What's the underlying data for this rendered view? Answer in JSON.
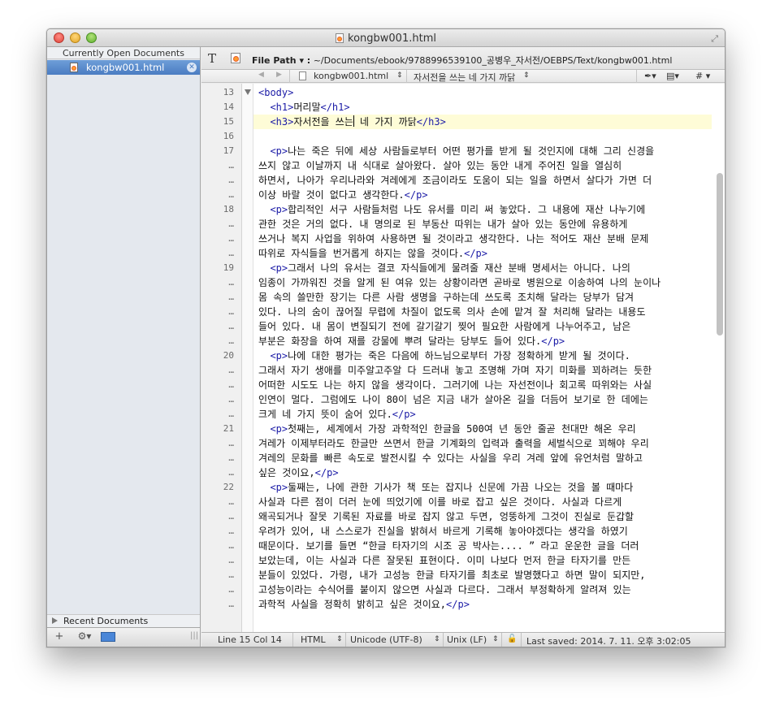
{
  "window": {
    "title": "kongbw001.html"
  },
  "sidebar": {
    "header": "Currently Open Documents",
    "open_docs": [
      {
        "name": "kongbw001.html"
      }
    ],
    "recent_label": "Recent Documents",
    "footer": {
      "add": "+",
      "gear": "⚙▾"
    }
  },
  "toolbar": {
    "text_icon": "T",
    "filepath_label": "File Path ▾ :",
    "filepath": "~/Documents/ebook/9788996539100_공병우_자서전/OEBPS/Text/kongbw001.html"
  },
  "navbar": {
    "back": "◀",
    "forward": "▶",
    "file": "kongbw001.html",
    "file_arrows": "⇕",
    "section": "자서전을 쓰는 네 가지 까닭",
    "section_arrows": "⇕",
    "pen": "✒▾",
    "doc": "▤▾",
    "hash": "# ▾"
  },
  "editor": {
    "line_numbers": [
      {
        "n": "13",
        "row": 0
      },
      {
        "n": "14",
        "row": 1
      },
      {
        "n": "15",
        "row": 2
      },
      {
        "n": "16",
        "row": 3
      },
      {
        "n": "17",
        "row": 4
      },
      {
        "n": "…",
        "row": 5
      },
      {
        "n": "…",
        "row": 6
      },
      {
        "n": "…",
        "row": 7
      },
      {
        "n": "18",
        "row": 8
      },
      {
        "n": "…",
        "row": 9
      },
      {
        "n": "…",
        "row": 10
      },
      {
        "n": "…",
        "row": 11
      },
      {
        "n": "19",
        "row": 12
      },
      {
        "n": "…",
        "row": 13
      },
      {
        "n": "…",
        "row": 14
      },
      {
        "n": "…",
        "row": 15
      },
      {
        "n": "…",
        "row": 16
      },
      {
        "n": "…",
        "row": 17
      },
      {
        "n": "20",
        "row": 18
      },
      {
        "n": "…",
        "row": 19
      },
      {
        "n": "…",
        "row": 20
      },
      {
        "n": "…",
        "row": 21
      },
      {
        "n": "…",
        "row": 22
      },
      {
        "n": "21",
        "row": 23
      },
      {
        "n": "…",
        "row": 24
      },
      {
        "n": "…",
        "row": 25
      },
      {
        "n": "…",
        "row": 26
      },
      {
        "n": "22",
        "row": 27
      },
      {
        "n": "…",
        "row": 28
      },
      {
        "n": "…",
        "row": 29
      },
      {
        "n": "…",
        "row": 30
      },
      {
        "n": "…",
        "row": 31
      },
      {
        "n": "…",
        "row": 32
      },
      {
        "n": "…",
        "row": 33
      },
      {
        "n": "…",
        "row": 34
      },
      {
        "n": "…",
        "row": 35
      }
    ],
    "lines": [
      "<span class=\"tag\">&lt;body&gt;</span>",
      "  <span class=\"tag\">&lt;h1&gt;</span>머리말<span class=\"tag\">&lt;/h1&gt;</span>",
      "  <span class=\"tag\">&lt;h3&gt;</span>자서전을 쓰는<span class=\"caret\"></span> 네 가지 까닭<span class=\"tag\">&lt;/h3&gt;</span>",
      "",
      "  <span class=\"tag\">&lt;p&gt;</span>나는 죽은 뒤에 세상 사람들로부터 어떤 평가를 받게 될 것인지에 대해 그리 신경을",
      "쓰지 않고 이날까지 내 식대로 살아왔다. 살아 있는 동안 내게 주어진 일을 열심히",
      "하면서, 나아가 우리나라와 겨레에게 조금이라도 도움이 되는 일을 하면서 살다가 가면 더",
      "이상 바랄 것이 없다고 생각한다.<span class=\"tag\">&lt;/p&gt;</span>",
      "  <span class=\"tag\">&lt;p&gt;</span>합리적인 서구 사람들처럼 나도 유서를 미리 써 놓았다. 그 내용에 재산 나누기에",
      "관한 것은 거의 없다. 내 명의로 된 부동산 따위는 내가 살아 있는 동안에 유용하게",
      "쓰거나 복지 사업을 위하여 사용하면 될 것이라고 생각한다. 나는 적어도 재산 분배 문제",
      "따위로 자식들을 번거롭게 하지는 않을 것이다.<span class=\"tag\">&lt;/p&gt;</span>",
      "  <span class=\"tag\">&lt;p&gt;</span>그래서 나의 유서는 결코 자식들에게 물려줄 재산 분배 명세서는 아니다. 나의",
      "임종이 가까워진 것을 알게 된 여유 있는 상황이라면 곧바로 병원으로 이송하여 나의 눈이나",
      "몸 속의 쓸만한 장기는 다른 사람 생명을 구하는데 쓰도록 조치해 달라는 당부가 담겨",
      "있다. 나의 숨이 끊어질 무렵에 차질이 없도록 의사 손에 맡겨 잘 처리해 달라는 내용도",
      "들어 있다. 내 몸이 변질되기 전에 갈기갈기 찢어 필요한 사람에게 나누어주고, 남은",
      "부분은 화장을 하여 재를 강물에 뿌려 달라는 당부도 들어 있다.<span class=\"tag\">&lt;/p&gt;</span>",
      "  <span class=\"tag\">&lt;p&gt;</span>나에 대한 평가는 죽은 다음에 하느님으로부터 가장 정확하게 받게 될 것이다.",
      "그래서 자기 생애를 미주알고주알 다 드러내 놓고 조명해 가며 자기 미화를 꾀하려는 듯한",
      "어떠한 시도도 나는 하지 않을 생각이다. 그러기에 나는 자선전이나 회고록 따위와는 사실",
      "인연이 멀다. 그럼에도 나이 80이 넘은 지금 내가 살아온 길을 더듬어 보기로 한 데에는",
      "크게 네 가지 뜻이 숨어 있다.<span class=\"tag\">&lt;/p&gt;</span>",
      "  <span class=\"tag\">&lt;p&gt;</span>첫째는, 세계에서 가장 과학적인 한글을 500여 년 동안 줄곧 천대만 해온 우리",
      "겨레가 이제부터라도 한글만 쓰면서 한글 기계화의 입력과 출력을 세벌식으로 꾀해야 우리",
      "겨레의 문화를 빠른 속도로 발전시킬 수 있다는 사실을 우리 겨레 앞에 유언처럼 말하고",
      "싶은 것이요,<span class=\"tag\">&lt;/p&gt;</span>",
      "  <span class=\"tag\">&lt;p&gt;</span>둘째는, 나에 관한 기사가 책 또는 잡지나 신문에 가끔 나오는 것을 볼 때마다",
      "사실과 다른 점이 더러 눈에 띄었기에 이를 바로 잡고 싶은 것이다. 사실과 다르게",
      "왜곡되거나 잘못 기록된 자료를 바로 잡지 않고 두면, 엉뚱하게 그것이 진실로 둔갑할",
      "우려가 있어, 내 스스로가 진실을 밝혀서 바르게 기록해 놓아야겠다는 생각을 하였기",
      "때문이다. 보기를 들면 “한글 타자기의 시조 공 박사는.... ” 라고 운운한 글을 더러",
      "보았는데, 이는 사실과 다른 잘못된 표현이다. 이미 나보다 먼저 한글 타자기를 만든",
      "분들이 있었다. 가령, 내가 고성능 한글 타자기를 최초로 발명했다고 하면 말이 되지만,",
      "고성능이라는 수식어를 붙이지 않으면 사실과 다르다. 그래서 부정확하게 알려져 있는",
      "과학적 사실을 정확히 밝히고 싶은 것이요,<span class=\"tag\">&lt;/p&gt;</span>"
    ]
  },
  "statusbar": {
    "position": "Line 15 Col 14",
    "syntax": "HTML",
    "encoding": "Unicode (UTF-8)",
    "line_endings": "Unix (LF)",
    "saved": "Last saved: 2014. 7. 11. 오후 3:02:05",
    "updown": "⇕"
  }
}
